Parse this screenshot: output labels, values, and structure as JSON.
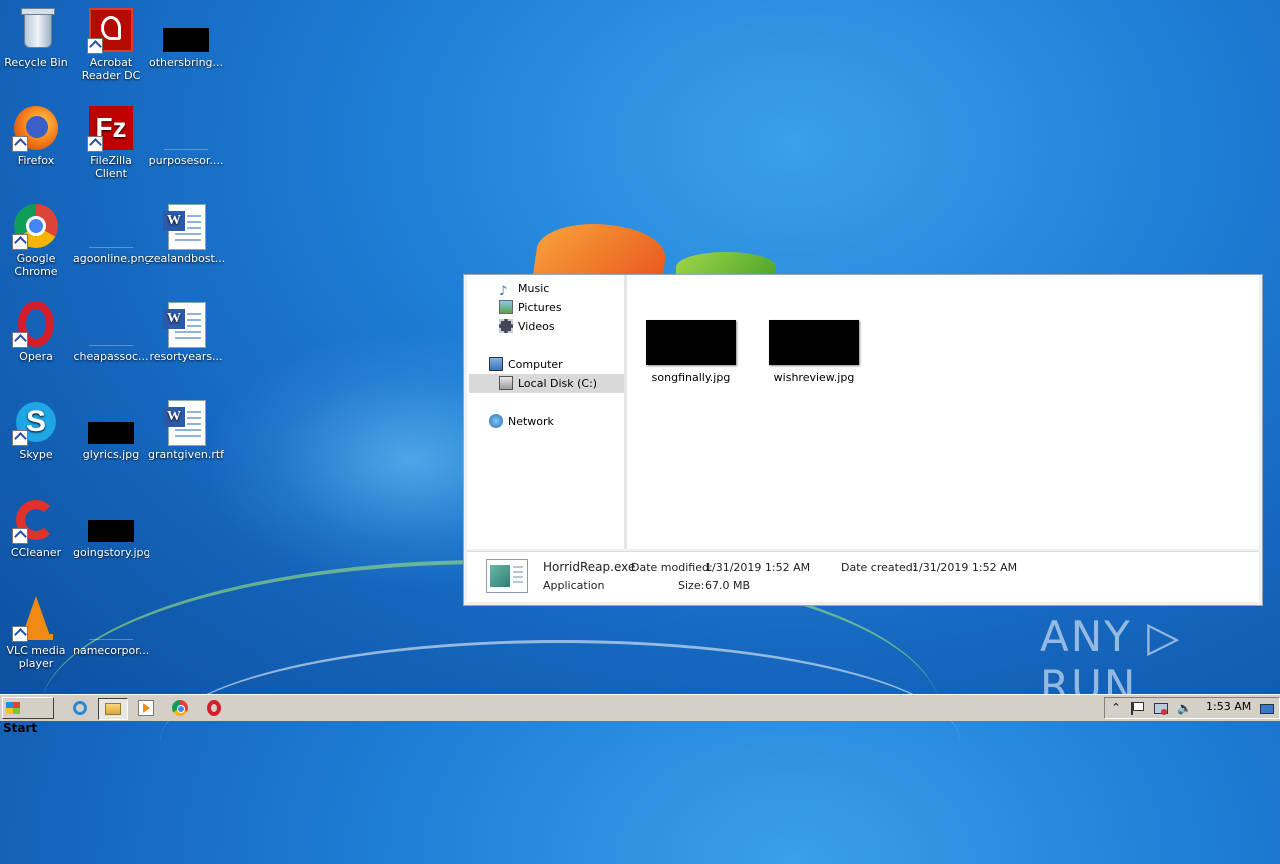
{
  "desktop": {
    "icons": [
      {
        "label": "Recycle Bin"
      },
      {
        "label": "Acrobat Reader DC"
      },
      {
        "label": "othersbring..."
      },
      {
        "label": "Firefox"
      },
      {
        "label": "FileZilla Client"
      },
      {
        "label": "purposesor...."
      },
      {
        "label": "Google Chrome"
      },
      {
        "label": "agoonline.png"
      },
      {
        "label": "zealandbost..."
      },
      {
        "label": "Opera"
      },
      {
        "label": "cheapassoc..."
      },
      {
        "label": "resortyears..."
      },
      {
        "label": "Skype"
      },
      {
        "label": "glyrics.jpg"
      },
      {
        "label": "grantgiven.rtf"
      },
      {
        "label": "CCleaner"
      },
      {
        "label": "goingstory.jpg"
      },
      {
        "label": "VLC media player"
      },
      {
        "label": "namecorpor..."
      }
    ]
  },
  "explorer": {
    "nav": {
      "music": "Music",
      "pictures": "Pictures",
      "videos": "Videos",
      "computer": "Computer",
      "local_disk": "Local Disk (C:)",
      "network": "Network"
    },
    "files": [
      {
        "name": "songfinally.jpg"
      },
      {
        "name": "wishreview.jpg"
      }
    ],
    "details": {
      "filename": "HorridReap.exe",
      "type": "Application",
      "modified_label": "Date modified:",
      "modified_value": "1/31/2019 1:52 AM",
      "created_label": "Date created:",
      "created_value": "1/31/2019 1:52 AM",
      "size_label": "Size:",
      "size_value": "67.0 MB"
    }
  },
  "watermark": "ANY ▷ RUN",
  "taskbar": {
    "start_label": "Start",
    "clock": "1:53 AM",
    "icons": [
      "ie-icon",
      "explorer-icon",
      "media-player-icon",
      "chrome-icon",
      "opera-icon"
    ]
  }
}
